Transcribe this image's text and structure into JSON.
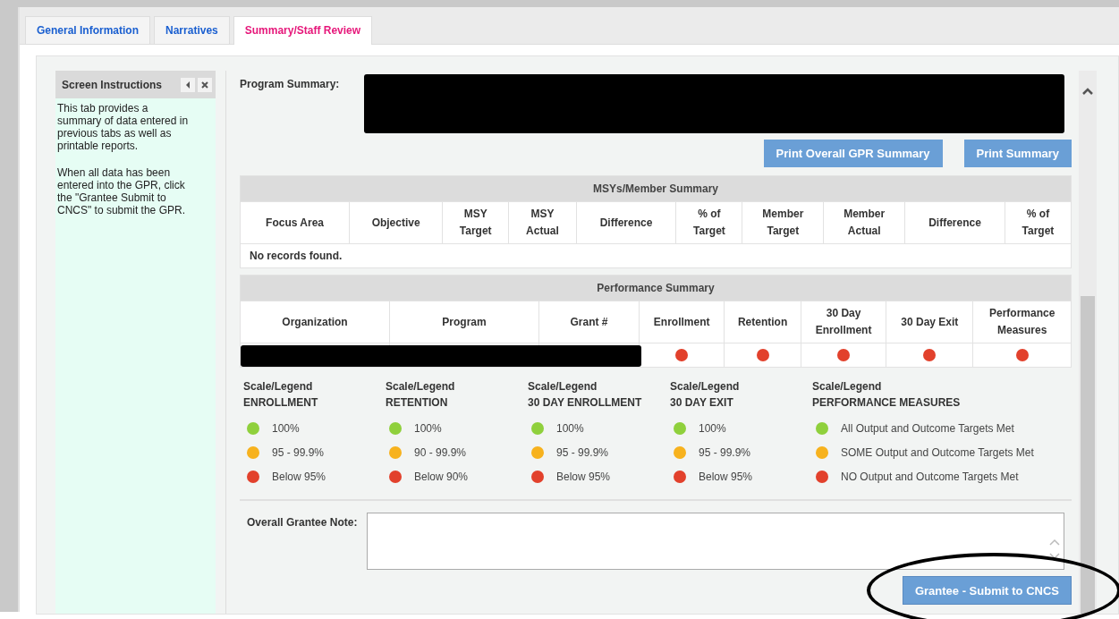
{
  "tabs": [
    {
      "label": "General Information",
      "selected": false
    },
    {
      "label": "Narratives",
      "selected": false
    },
    {
      "label": "Summary/Staff Review",
      "selected": true
    }
  ],
  "instructions": {
    "title": "Screen Instructions",
    "paragraphs": [
      "This tab provides a summary of data entered in previous tabs as well as printable reports.",
      "When all data has been entered into the GPR, click the \"Grantee Submit to CNCS\" to submit the GPR."
    ]
  },
  "program_summary": {
    "label": "Program Summary:"
  },
  "buttons": [
    "Print Overall GPR Summary",
    "Print Summary"
  ],
  "msy_table": {
    "title": "MSYs/Member Summary",
    "columns": [
      {
        "lines": [
          "Focus Area"
        ]
      },
      {
        "lines": [
          "Objective"
        ]
      },
      {
        "lines": [
          "MSY",
          "Target"
        ]
      },
      {
        "lines": [
          "MSY",
          "Actual"
        ]
      },
      {
        "lines": [
          "Difference"
        ]
      },
      {
        "lines": [
          "% of",
          "Target"
        ]
      },
      {
        "lines": [
          "Member",
          "Target"
        ]
      },
      {
        "lines": [
          "Member",
          "Actual"
        ]
      },
      {
        "lines": [
          "Difference"
        ]
      },
      {
        "lines": [
          "% of",
          "Target"
        ]
      }
    ],
    "empty_message": "No records found."
  },
  "performance_table": {
    "title": "Performance Summary",
    "columns": [
      {
        "lines": [
          "Organization"
        ]
      },
      {
        "lines": [
          "Program"
        ]
      },
      {
        "lines": [
          "Grant #"
        ]
      },
      {
        "lines": [
          "Enrollment"
        ]
      },
      {
        "lines": [
          "Retention"
        ]
      },
      {
        "lines": [
          "30 Day",
          "Enrollment"
        ]
      },
      {
        "lines": [
          "30 Day Exit"
        ]
      },
      {
        "lines": [
          "Performance",
          "Measures"
        ]
      }
    ],
    "rows": [
      {
        "indicators": [
          {
            "color": "#e2412c"
          },
          {
            "color": "#e2412c"
          },
          {
            "color": "#e2412c"
          },
          {
            "color": "#e2412c"
          },
          {
            "color": "#e2412c"
          }
        ]
      }
    ]
  },
  "legends": [
    {
      "caption": "Scale/Legend",
      "heading": "ENROLLMENT",
      "items": [
        {
          "color": "#8fd03c",
          "label": "100%"
        },
        {
          "color": "#f7b21e",
          "label": "95 - 99.9%"
        },
        {
          "color": "#e2412c",
          "label": "Below 95%"
        }
      ]
    },
    {
      "caption": "Scale/Legend",
      "heading": "RETENTION",
      "items": [
        {
          "color": "#8fd03c",
          "label": "100%"
        },
        {
          "color": "#f7b21e",
          "label": "90 - 99.9%"
        },
        {
          "color": "#e2412c",
          "label": "Below 90%"
        }
      ]
    },
    {
      "caption": "Scale/Legend",
      "heading": "30 DAY ENROLLMENT",
      "items": [
        {
          "color": "#8fd03c",
          "label": "100%"
        },
        {
          "color": "#f7b21e",
          "label": "95 - 99.9%"
        },
        {
          "color": "#e2412c",
          "label": "Below 95%"
        }
      ]
    },
    {
      "caption": "Scale/Legend",
      "heading": "30 DAY EXIT",
      "items": [
        {
          "color": "#8fd03c",
          "label": "100%"
        },
        {
          "color": "#f7b21e",
          "label": "95 - 99.9%"
        },
        {
          "color": "#e2412c",
          "label": "Below 95%"
        }
      ]
    },
    {
      "caption": "Scale/Legend",
      "heading": "PERFORMANCE MEASURES",
      "items": [
        {
          "color": "#8fd03c",
          "label": "All Output and Outcome Targets Met"
        },
        {
          "color": "#f7b21e",
          "label": "SOME Output and Outcome Targets Met"
        },
        {
          "color": "#e2412c",
          "label": "NO Output and Outcome Targets Met"
        }
      ]
    }
  ],
  "note": {
    "label": "Overall Grantee Note:"
  },
  "submit_button": "Grantee - Submit to CNCS"
}
